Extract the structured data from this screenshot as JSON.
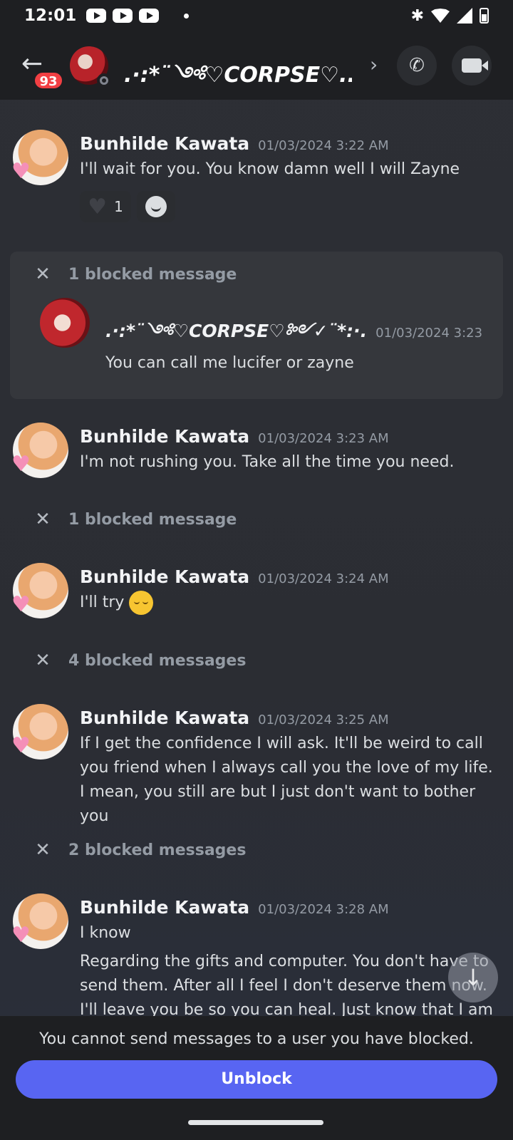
{
  "status_bar": {
    "time": "12:01"
  },
  "header": {
    "badge_count": "93",
    "channel_title": ".·:*¨༺♡CORPSE♡...",
    "icons": [
      "back-arrow-icon",
      "chevron-right-icon",
      "phone-call-icon",
      "video-call-icon"
    ]
  },
  "messages": [
    {
      "author": "Bunhilde Kawata",
      "time": "01/03/2024 3:22 AM",
      "text": "I'll wait for you. You know damn well I will Zayne",
      "reactions": [
        {
          "icon": "heart-icon",
          "count": "1"
        }
      ]
    },
    {
      "author": "Bunhilde Kawata",
      "time": "01/03/2024 3:23 AM",
      "text": "I'm not rushing you. Take all the time you need."
    },
    {
      "author": "Bunhilde Kawata",
      "time": "01/03/2024 3:24 AM",
      "text": "I'll try"
    },
    {
      "author": "Bunhilde Kawata",
      "time": "01/03/2024 3:25 AM",
      "text": "If I get the confidence I will ask. It'll be weird to call you friend when I always call you the love of my life. I mean, you still are but I just don't want to bother you"
    },
    {
      "author": "Bunhilde Kawata",
      "time": "01/03/2024 3:28 AM",
      "text": "I know",
      "text2": "Regarding the gifts and computer. You don't have to send them. After all I feel I don't deserve them now. I'll leave you be so you can heal. Just know that I am forever sorry"
    }
  ],
  "blocked": {
    "expanded_label": "1 blocked message",
    "inner_author": ".·:*¨༺♡CORPSE♡༻✓¨*:·.",
    "inner_time": "01/03/2024 3:23",
    "inner_text": "You can call me lucifer or zayne",
    "collapsed": [
      "1 blocked message",
      "4 blocked messages",
      "2 blocked messages"
    ]
  },
  "footer": {
    "notice": "You cannot send messages to a user you have blocked.",
    "unblock_label": "Unblock"
  },
  "colors": {
    "accent": "#5865f2",
    "badge": "#f23f43"
  }
}
